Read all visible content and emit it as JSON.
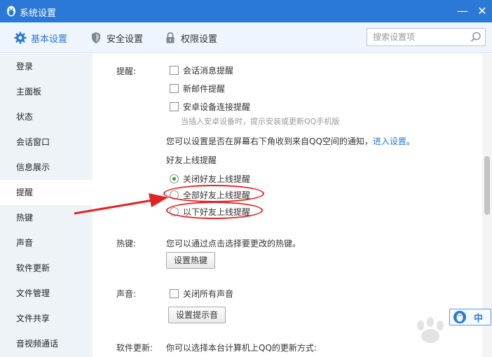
{
  "window": {
    "title": "系统设置",
    "minimize_glyph": "—",
    "close_glyph": "✕"
  },
  "tabs": [
    {
      "label": "基本设置",
      "icon": "gear-icon",
      "active": true
    },
    {
      "label": "安全设置",
      "icon": "shield-icon",
      "active": false
    },
    {
      "label": "权限设置",
      "icon": "lock-icon",
      "active": false
    }
  ],
  "search": {
    "placeholder": "搜索设置项",
    "value": ""
  },
  "sidebar": {
    "items": [
      {
        "label": "登录"
      },
      {
        "label": "主面板"
      },
      {
        "label": "状态"
      },
      {
        "label": "会话窗口"
      },
      {
        "label": "信息展示"
      },
      {
        "label": "提醒",
        "active": true
      },
      {
        "label": "热键"
      },
      {
        "label": "声音"
      },
      {
        "label": "软件更新"
      },
      {
        "label": "文件管理"
      },
      {
        "label": "文件共享"
      },
      {
        "label": "音视频通话"
      }
    ]
  },
  "reminder": {
    "section_label": "提醒:",
    "chat_msg": {
      "label": "会话消息提醒",
      "checked": false
    },
    "new_mail": {
      "label": "新邮件提醒",
      "checked": false
    },
    "android": {
      "label": "安卓设备连接提醒",
      "checked": false
    },
    "android_hint": "当插入安卓设备时，提示安装或更新QQ手机版",
    "qzone_text": "您可以设置是否在屏幕右下角收到来自QQ空间的通知，",
    "qzone_link": "进入设置",
    "qzone_end": "。",
    "friend_online_title": "好友上线提醒",
    "options": [
      {
        "label": "关闭好友上线提醒",
        "selected": true
      },
      {
        "label": "全部好友上线提醒",
        "selected": false
      },
      {
        "label": "以下好友上线提醒",
        "selected": false
      }
    ]
  },
  "hotkey": {
    "section_label": "热键:",
    "desc": "您可以通过点击选择要更改的热键。",
    "button": "设置热键"
  },
  "sound": {
    "section_label": "声音:",
    "mute_all": {
      "label": "关闭所有声音",
      "checked": false
    },
    "button": "设置提示音"
  },
  "update": {
    "section_label": "软件更新:",
    "desc": "你可以选择本台计算机上QQ的更新方式:"
  },
  "ime": {
    "text": "中"
  },
  "colors": {
    "titlebar": "#2b79d6",
    "accent": "#2b79d6",
    "annotation": "#e02424"
  }
}
